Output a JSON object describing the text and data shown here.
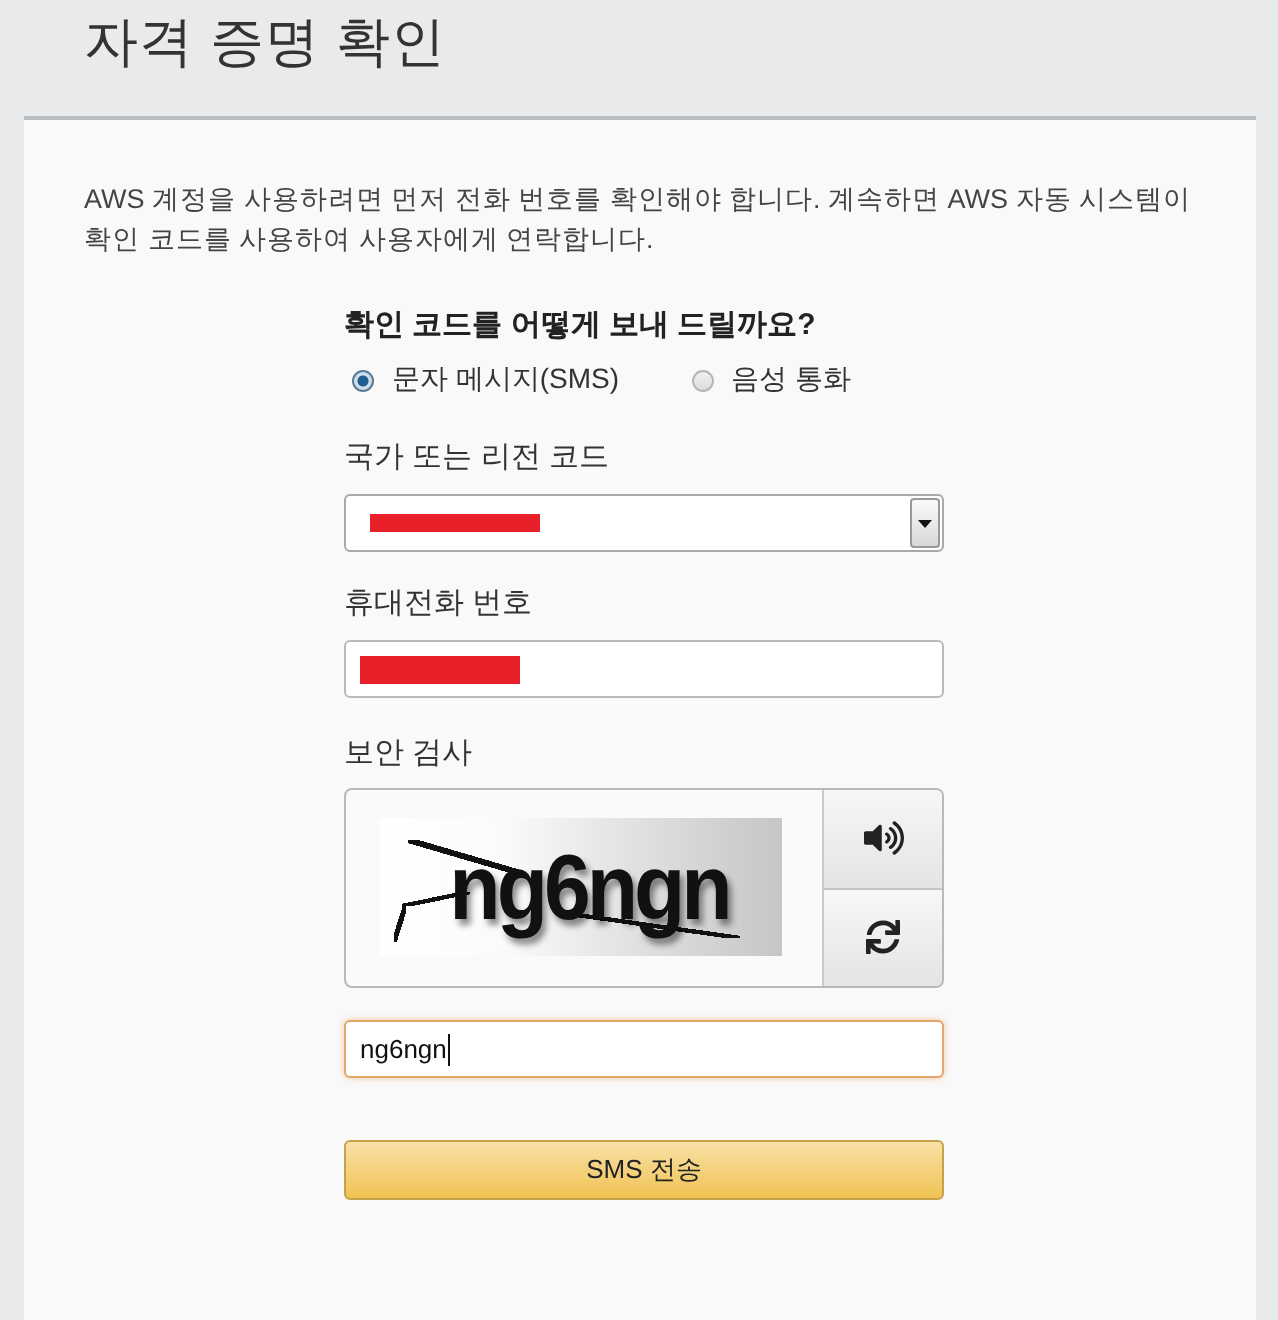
{
  "page_title": "자격 증명 확인",
  "intro": "AWS 계정을 사용하려면 먼저 전화 번호를 확인해야 합니다. 계속하면 AWS 자동 시스템이 확인 코드를 사용하여 사용자에게 연락합니다.",
  "form": {
    "question": "확인 코드를 어떻게 보내 드릴까요?",
    "methods": [
      {
        "label": "문자 메시지(SMS)",
        "selected": true
      },
      {
        "label": "음성 통화",
        "selected": false
      }
    ],
    "fields": [
      {
        "kind": "select",
        "label": "국가 또는 리전 코드",
        "redacted": true
      },
      {
        "kind": "text",
        "label": "휴대전화 번호",
        "redacted": true
      }
    ],
    "security_check": {
      "label": "보안 검사",
      "captcha_text": "ng6ngn",
      "answer": {
        "value": "ng6ngn",
        "focused": true
      }
    },
    "submit": "SMS 전송"
  }
}
